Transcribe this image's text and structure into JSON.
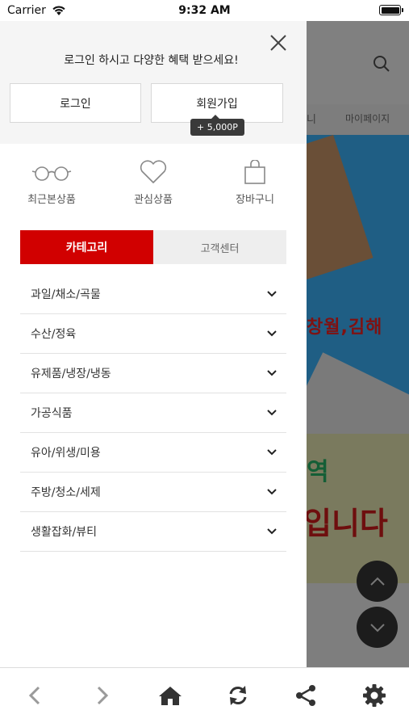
{
  "status_bar": {
    "carrier": "Carrier",
    "time": "9:32 AM"
  },
  "drawer": {
    "promo_text": "로그인 하시고 다양한 혜택 받으세요!",
    "login_label": "로그인",
    "join_label": "회원가입",
    "join_point_badge": "+ 5,000P",
    "quick_links": [
      {
        "label": "최근본상품",
        "icon": "glasses-icon"
      },
      {
        "label": "관심상품",
        "icon": "heart-icon"
      },
      {
        "label": "장바구니",
        "icon": "shopping-bag-icon"
      }
    ],
    "tabs": [
      {
        "label": "카테고리",
        "active": true
      },
      {
        "label": "고객센터",
        "active": false
      }
    ],
    "categories": [
      "과일/채소/곡물",
      "수산/정육",
      "유제품/냉장/냉동",
      "가공식품",
      "유아/위생/미용",
      "주방/청소/세제",
      "생활잡화/뷰티"
    ]
  },
  "background_page": {
    "tab_partial": "니",
    "tab_mypage": "마이페이지",
    "banner_text_1": "창월,김해",
    "banner_text_2": "역",
    "banner_text_3": "입니다"
  },
  "toolbar": {
    "items": [
      "back-icon",
      "forward-icon",
      "home-icon",
      "refresh-icon",
      "share-icon",
      "settings-icon"
    ]
  },
  "colors": {
    "accent": "#d10000",
    "overlay": "#7f7f7f"
  }
}
